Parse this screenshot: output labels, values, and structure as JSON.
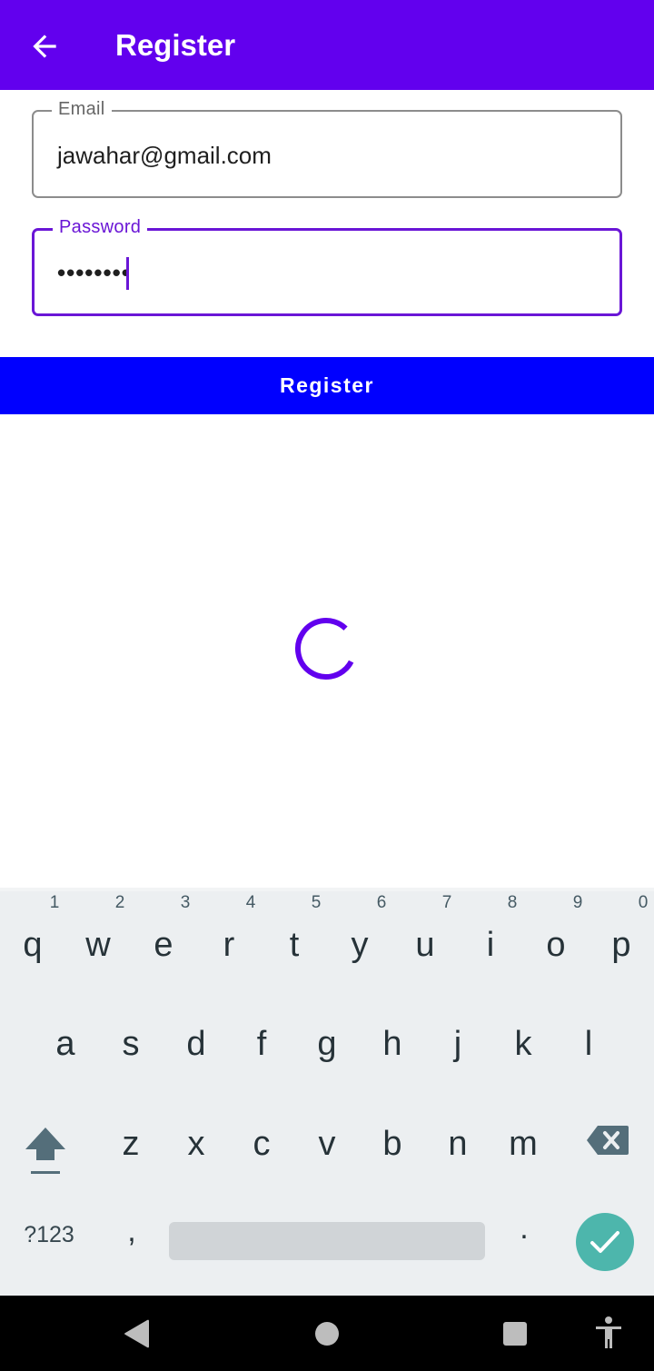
{
  "app_bar": {
    "title": "Register",
    "background_color": "#6200ee",
    "back_icon": "arrow-back-icon"
  },
  "form": {
    "email": {
      "label": "Email",
      "value": "jawahar@gmail.com"
    },
    "password": {
      "label": "Password",
      "masked_value": "••••••••",
      "focused": true,
      "accent_color": "#6a16d6"
    },
    "register_button": {
      "label": "Register",
      "background_color": "#0000ff"
    }
  },
  "loading": {
    "indicator": "circular-progress",
    "color": "#6200ee"
  },
  "keyboard": {
    "row1": [
      {
        "key": "q",
        "sup": "1"
      },
      {
        "key": "w",
        "sup": "2"
      },
      {
        "key": "e",
        "sup": "3"
      },
      {
        "key": "r",
        "sup": "4"
      },
      {
        "key": "t",
        "sup": "5"
      },
      {
        "key": "y",
        "sup": "6"
      },
      {
        "key": "u",
        "sup": "7"
      },
      {
        "key": "i",
        "sup": "8"
      },
      {
        "key": "o",
        "sup": "9"
      },
      {
        "key": "p",
        "sup": "0"
      }
    ],
    "row2": [
      "a",
      "s",
      "d",
      "f",
      "g",
      "h",
      "j",
      "k",
      "l"
    ],
    "row3": [
      "z",
      "x",
      "c",
      "v",
      "b",
      "n",
      "m"
    ],
    "symbols_label": "?123",
    "comma": ",",
    "period": ".",
    "shift_icon": "shift-icon",
    "backspace_icon": "backspace-icon",
    "enter_icon": "check-icon",
    "enter_color": "#4db6ac"
  },
  "nav_bar": {
    "back": "nav-back-icon",
    "home": "nav-home-icon",
    "recents": "nav-recents-icon",
    "accessibility": "accessibility-icon"
  }
}
